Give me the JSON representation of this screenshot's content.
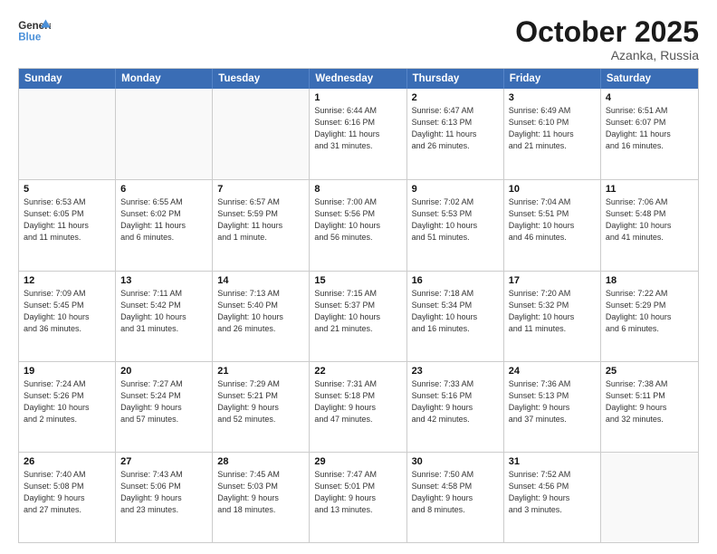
{
  "header": {
    "logo_line1": "General",
    "logo_line2": "Blue",
    "month": "October 2025",
    "location": "Azanka, Russia"
  },
  "weekdays": [
    "Sunday",
    "Monday",
    "Tuesday",
    "Wednesday",
    "Thursday",
    "Friday",
    "Saturday"
  ],
  "weeks": [
    [
      {
        "day": "",
        "info": ""
      },
      {
        "day": "",
        "info": ""
      },
      {
        "day": "",
        "info": ""
      },
      {
        "day": "1",
        "info": "Sunrise: 6:44 AM\nSunset: 6:16 PM\nDaylight: 11 hours\nand 31 minutes."
      },
      {
        "day": "2",
        "info": "Sunrise: 6:47 AM\nSunset: 6:13 PM\nDaylight: 11 hours\nand 26 minutes."
      },
      {
        "day": "3",
        "info": "Sunrise: 6:49 AM\nSunset: 6:10 PM\nDaylight: 11 hours\nand 21 minutes."
      },
      {
        "day": "4",
        "info": "Sunrise: 6:51 AM\nSunset: 6:07 PM\nDaylight: 11 hours\nand 16 minutes."
      }
    ],
    [
      {
        "day": "5",
        "info": "Sunrise: 6:53 AM\nSunset: 6:05 PM\nDaylight: 11 hours\nand 11 minutes."
      },
      {
        "day": "6",
        "info": "Sunrise: 6:55 AM\nSunset: 6:02 PM\nDaylight: 11 hours\nand 6 minutes."
      },
      {
        "day": "7",
        "info": "Sunrise: 6:57 AM\nSunset: 5:59 PM\nDaylight: 11 hours\nand 1 minute."
      },
      {
        "day": "8",
        "info": "Sunrise: 7:00 AM\nSunset: 5:56 PM\nDaylight: 10 hours\nand 56 minutes."
      },
      {
        "day": "9",
        "info": "Sunrise: 7:02 AM\nSunset: 5:53 PM\nDaylight: 10 hours\nand 51 minutes."
      },
      {
        "day": "10",
        "info": "Sunrise: 7:04 AM\nSunset: 5:51 PM\nDaylight: 10 hours\nand 46 minutes."
      },
      {
        "day": "11",
        "info": "Sunrise: 7:06 AM\nSunset: 5:48 PM\nDaylight: 10 hours\nand 41 minutes."
      }
    ],
    [
      {
        "day": "12",
        "info": "Sunrise: 7:09 AM\nSunset: 5:45 PM\nDaylight: 10 hours\nand 36 minutes."
      },
      {
        "day": "13",
        "info": "Sunrise: 7:11 AM\nSunset: 5:42 PM\nDaylight: 10 hours\nand 31 minutes."
      },
      {
        "day": "14",
        "info": "Sunrise: 7:13 AM\nSunset: 5:40 PM\nDaylight: 10 hours\nand 26 minutes."
      },
      {
        "day": "15",
        "info": "Sunrise: 7:15 AM\nSunset: 5:37 PM\nDaylight: 10 hours\nand 21 minutes."
      },
      {
        "day": "16",
        "info": "Sunrise: 7:18 AM\nSunset: 5:34 PM\nDaylight: 10 hours\nand 16 minutes."
      },
      {
        "day": "17",
        "info": "Sunrise: 7:20 AM\nSunset: 5:32 PM\nDaylight: 10 hours\nand 11 minutes."
      },
      {
        "day": "18",
        "info": "Sunrise: 7:22 AM\nSunset: 5:29 PM\nDaylight: 10 hours\nand 6 minutes."
      }
    ],
    [
      {
        "day": "19",
        "info": "Sunrise: 7:24 AM\nSunset: 5:26 PM\nDaylight: 10 hours\nand 2 minutes."
      },
      {
        "day": "20",
        "info": "Sunrise: 7:27 AM\nSunset: 5:24 PM\nDaylight: 9 hours\nand 57 minutes."
      },
      {
        "day": "21",
        "info": "Sunrise: 7:29 AM\nSunset: 5:21 PM\nDaylight: 9 hours\nand 52 minutes."
      },
      {
        "day": "22",
        "info": "Sunrise: 7:31 AM\nSunset: 5:18 PM\nDaylight: 9 hours\nand 47 minutes."
      },
      {
        "day": "23",
        "info": "Sunrise: 7:33 AM\nSunset: 5:16 PM\nDaylight: 9 hours\nand 42 minutes."
      },
      {
        "day": "24",
        "info": "Sunrise: 7:36 AM\nSunset: 5:13 PM\nDaylight: 9 hours\nand 37 minutes."
      },
      {
        "day": "25",
        "info": "Sunrise: 7:38 AM\nSunset: 5:11 PM\nDaylight: 9 hours\nand 32 minutes."
      }
    ],
    [
      {
        "day": "26",
        "info": "Sunrise: 7:40 AM\nSunset: 5:08 PM\nDaylight: 9 hours\nand 27 minutes."
      },
      {
        "day": "27",
        "info": "Sunrise: 7:43 AM\nSunset: 5:06 PM\nDaylight: 9 hours\nand 23 minutes."
      },
      {
        "day": "28",
        "info": "Sunrise: 7:45 AM\nSunset: 5:03 PM\nDaylight: 9 hours\nand 18 minutes."
      },
      {
        "day": "29",
        "info": "Sunrise: 7:47 AM\nSunset: 5:01 PM\nDaylight: 9 hours\nand 13 minutes."
      },
      {
        "day": "30",
        "info": "Sunrise: 7:50 AM\nSunset: 4:58 PM\nDaylight: 9 hours\nand 8 minutes."
      },
      {
        "day": "31",
        "info": "Sunrise: 7:52 AM\nSunset: 4:56 PM\nDaylight: 9 hours\nand 3 minutes."
      },
      {
        "day": "",
        "info": ""
      }
    ]
  ]
}
